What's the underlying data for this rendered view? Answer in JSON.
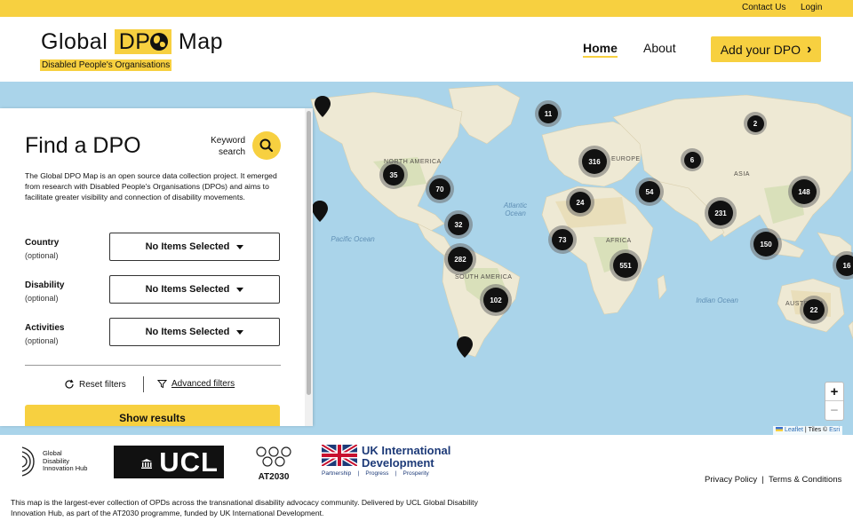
{
  "topbar": {
    "contact": "Contact Us",
    "login": "Login"
  },
  "logo": {
    "word1": "Global",
    "dpo": "DP",
    "word2": "Map",
    "subtitle": "Disabled People's Organisations"
  },
  "nav": {
    "home": "Home",
    "about": "About",
    "add_button": "Add your DPO",
    "add_chevron": "›"
  },
  "panel": {
    "title": "Find a DPO",
    "keyword_label": "Keyword search",
    "description": "The Global DPO Map is an open source data collection project. It emerged from research with Disabled People's Organisations (DPOs) and aims to facilitate greater visibility and connection of disability movements.",
    "filters": [
      {
        "label": "Country",
        "optional": "(optional)",
        "value": "No Items Selected"
      },
      {
        "label": "Disability",
        "optional": "(optional)",
        "value": "No Items Selected"
      },
      {
        "label": "Activities",
        "optional": "(optional)",
        "value": "No Items Selected"
      }
    ],
    "reset": "Reset filters",
    "advanced": "Advanced filters",
    "show_results": "Show results"
  },
  "map": {
    "ocean_labels": {
      "atlantic": "Atlantic Ocean",
      "pacific": "Pacific Ocean",
      "indian": "Indian Ocean"
    },
    "continent_labels": {
      "north_america": "NORTH AMERICA",
      "south_america": "SOUTH AMERICA",
      "europe": "EUROPE",
      "africa": "AFRICA",
      "asia": "ASIA",
      "australia": "AUSTRALIA"
    },
    "clusters": [
      "11",
      "2",
      "316",
      "6",
      "35",
      "70",
      "148",
      "24",
      "54",
      "231",
      "32",
      "73",
      "150",
      "282",
      "551",
      "16",
      "102",
      "22"
    ],
    "zoom_in": "+",
    "zoom_out": "−",
    "attribution": {
      "leaflet": "Leaflet",
      "sep": " | Tiles © ",
      "esri": "Esri"
    }
  },
  "footer": {
    "gdih": "Global Disability Innovation Hub",
    "ucl": "UCL",
    "at2030": "AT2030",
    "ukid_line1": "UK International",
    "ukid_line2": "Development",
    "ukid_tagline": "Partnership    |    Progress    |    Prosperity",
    "privacy": "Privacy Policy",
    "sep": "|",
    "terms": "Terms & Conditions",
    "description": "This map is the largest-ever collection of OPDs across the transnational disability advocacy community. Delivered by UCL Global Disability Innovation Hub, as part of the AT2030 programme, funded by UK International Development."
  },
  "colors": {
    "brand_yellow": "#f7d040",
    "ocean": "#aad4ea",
    "land": "#eee9d4",
    "cluster": "#111111"
  }
}
